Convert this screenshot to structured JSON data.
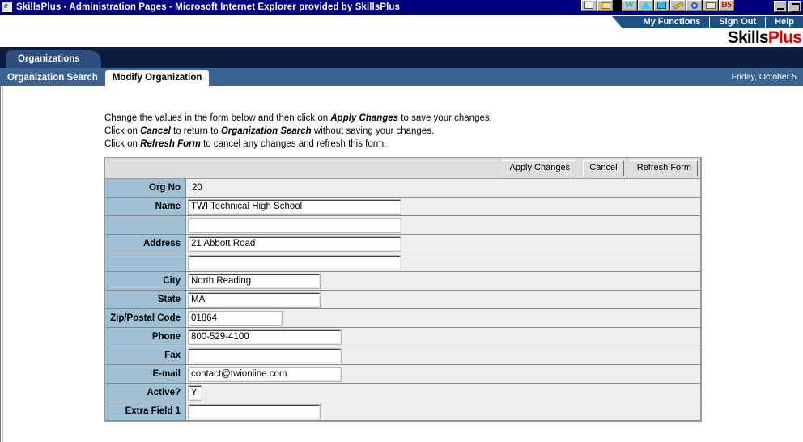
{
  "window": {
    "title": "SkillsPlus - Administration Pages - Microsoft Internet Explorer provided by SkillsPlus",
    "icon": "internet-explorer-icon",
    "minimize_label": "Minimize",
    "maximize_label": "Maximize",
    "toolbar_icons": [
      "new-document-icon",
      "open-folder-icon",
      "word-icon",
      "compass-icon",
      "screen-icon",
      "key-icon",
      "magnifier-icon",
      "envelope-icon",
      "design-icon"
    ]
  },
  "header": {
    "nav": [
      {
        "label": "My Functions"
      },
      {
        "label": "Sign Out"
      },
      {
        "label": "Help"
      }
    ],
    "logo_first": "Skills",
    "logo_second": "Plus",
    "logo_colors": {
      "first": "#000000",
      "second": "#e00000"
    }
  },
  "tabs": {
    "main_tab": "Organizations",
    "sub_tabs": [
      {
        "label": "Organization Search",
        "active": false
      },
      {
        "label": "Modify Organization",
        "active": true
      }
    ],
    "date": "Friday, October 5"
  },
  "instructions": {
    "line1_a": "Change the values in the form below and then click on ",
    "line1_b": "Apply Changes",
    "line1_c": " to save your changes.",
    "line2_a": "Click on ",
    "line2_b": "Cancel",
    "line2_c": " to return to ",
    "line2_d": "Organization Search",
    "line2_e": " without saving your changes.",
    "line3_a": "Click on ",
    "line3_b": "Refresh Form",
    "line3_c": " to cancel any changes and refresh this form."
  },
  "form": {
    "buttons": [
      {
        "label": "Apply Changes"
      },
      {
        "label": "Cancel"
      },
      {
        "label": "Refresh Form"
      }
    ],
    "rows": [
      {
        "label": "Org No",
        "value": "20",
        "type": "text",
        "width": ""
      },
      {
        "label": "Name",
        "value": "TWI Technical High School",
        "type": "input",
        "width": "w-lg"
      },
      {
        "label": "",
        "value": "",
        "type": "input",
        "width": "w-lg"
      },
      {
        "label": "Address",
        "value": "21 Abbott Road",
        "type": "input",
        "width": "w-lg"
      },
      {
        "label": "",
        "value": "",
        "type": "input",
        "width": "w-lg"
      },
      {
        "label": "City",
        "value": "North Reading",
        "type": "input",
        "width": "w-md"
      },
      {
        "label": "State",
        "value": "MA",
        "type": "input",
        "width": "w-md"
      },
      {
        "label": "Zip/Postal Code",
        "value": "01864",
        "type": "input",
        "width": "w-sm"
      },
      {
        "label": "Phone",
        "value": "800-529-4100",
        "type": "input",
        "width": "w-ph"
      },
      {
        "label": "Fax",
        "value": "",
        "type": "input",
        "width": "w-ph"
      },
      {
        "label": "E-mail",
        "value": "contact@twionline.com",
        "type": "input",
        "width": "w-ph"
      },
      {
        "label": "Active?",
        "value": "Y",
        "type": "input",
        "width": "w-xs"
      },
      {
        "label": "Extra Field 1",
        "value": "",
        "type": "input",
        "width": "w-md"
      }
    ]
  },
  "colors": {
    "titlebar": "#00007f",
    "tabband": "#0d1b3e",
    "subnav": "#3c6493",
    "label_cell": "#9fc0d2",
    "panel": "#eeeeee"
  }
}
